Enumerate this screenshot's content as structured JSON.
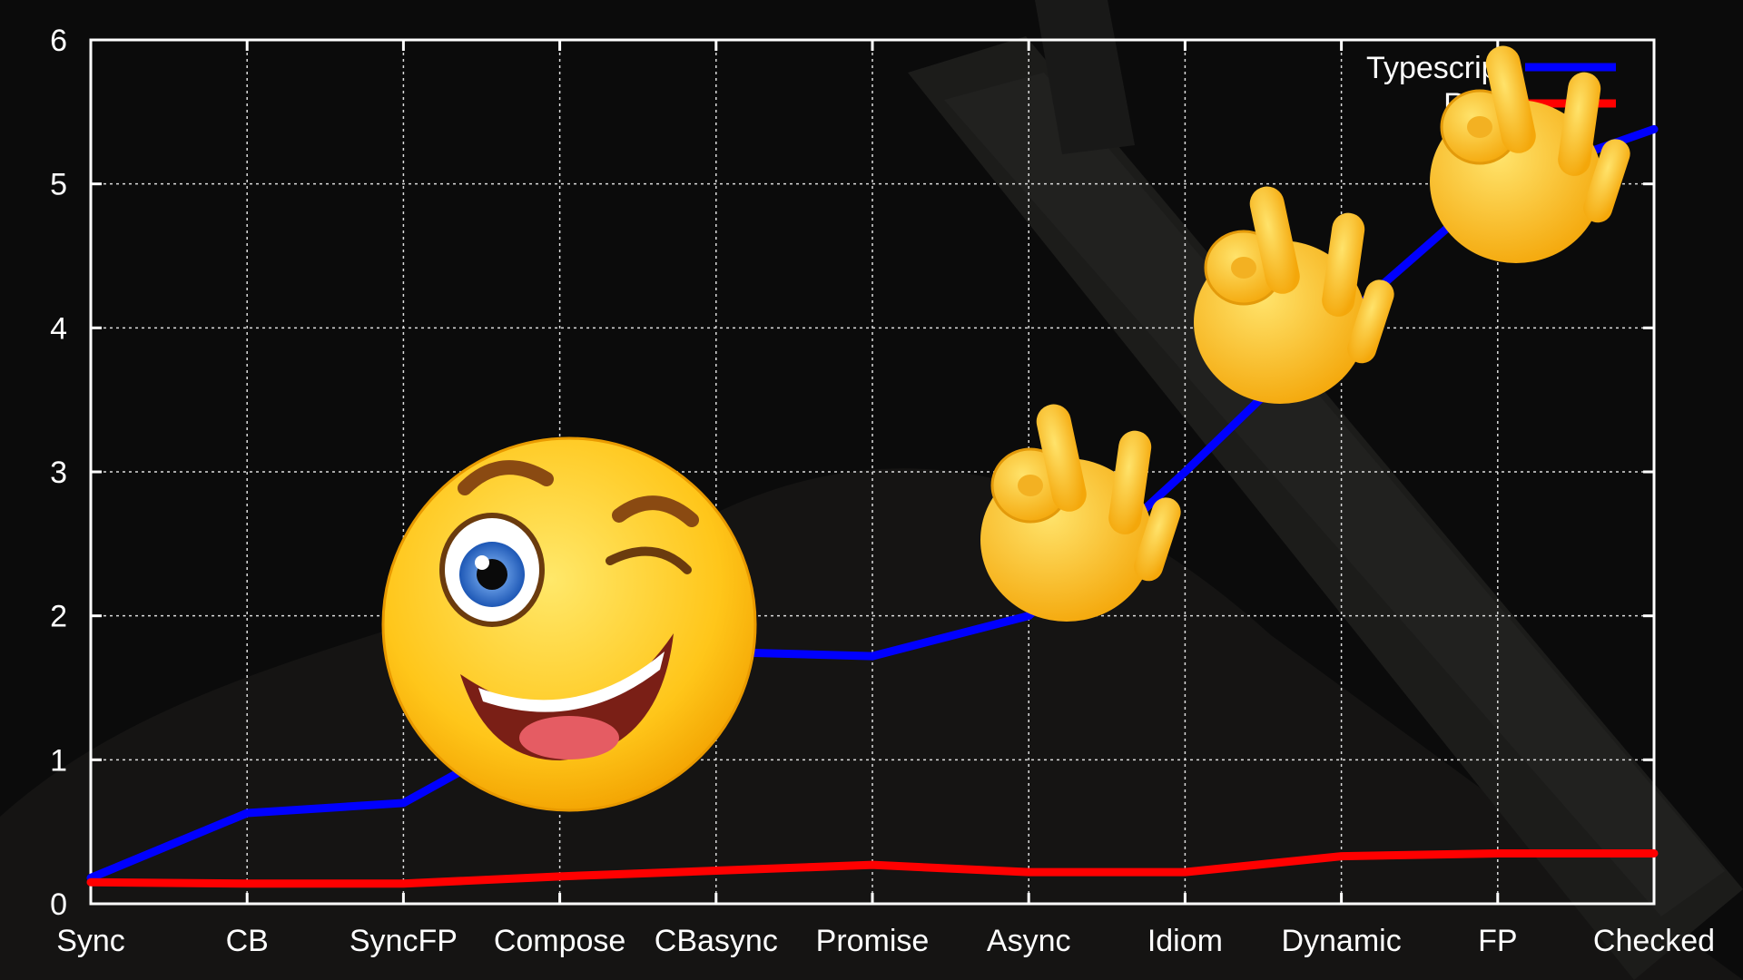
{
  "chart_data": {
    "type": "line",
    "categories": [
      "Sync",
      "CB",
      "SyncFP",
      "Compose",
      "CBasync",
      "Promise",
      "Async",
      "Idiom",
      "Dynamic",
      "FP",
      "Checked"
    ],
    "series": [
      {
        "name": "Typescript",
        "color": "#0000ff",
        "values": [
          0.18,
          0.63,
          0.7,
          1.3,
          1.75,
          1.72,
          2.0,
          3.0,
          4.05,
          5.0,
          5.38
        ]
      },
      {
        "name": "Rust",
        "color": "#ff0000",
        "values": [
          0.15,
          0.14,
          0.14,
          0.19,
          0.23,
          0.27,
          0.22,
          0.22,
          0.33,
          0.35,
          0.35
        ]
      }
    ],
    "ylim": [
      0,
      6
    ],
    "yticks": [
      "0",
      "1",
      "2",
      "3",
      "4",
      "5",
      "6"
    ],
    "xlabel": "",
    "ylabel": "",
    "title": "",
    "grid": true,
    "legend": "top-right"
  },
  "decorations": {
    "background": "dark photo of a vernier caliper",
    "stickers": [
      "winking-smiley-face",
      "ok-hand",
      "ok-hand",
      "ok-hand"
    ]
  }
}
